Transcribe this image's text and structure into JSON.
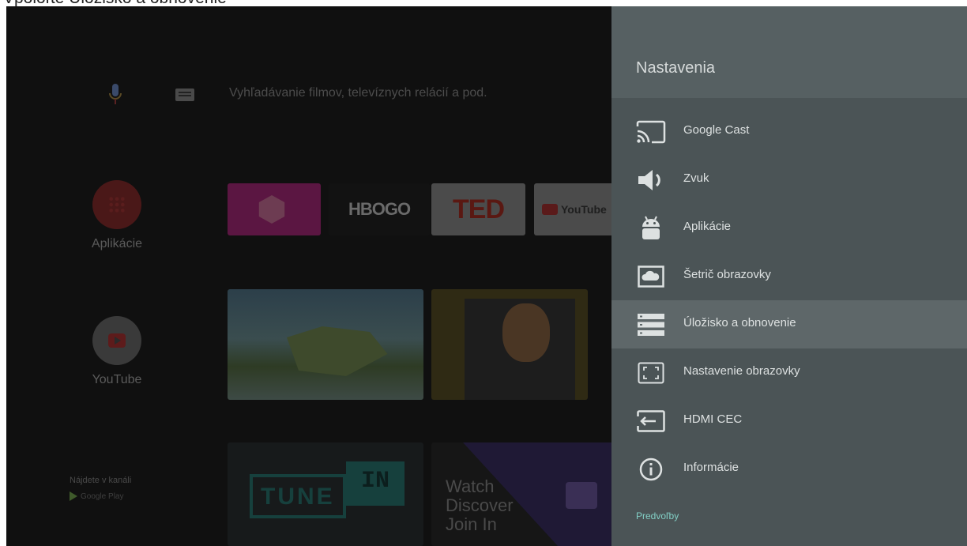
{
  "caption": "Vpoloľte Úložisko a obnovenie",
  "home": {
    "search_placeholder": "Vyhľadávanie filmov, televíznych relácií a pod.",
    "side_apps": [
      {
        "label": "Aplikácie"
      },
      {
        "label": "YouTube"
      }
    ],
    "playstore_line1": "Nájdete v kanáli",
    "playstore_line2": "Google Play",
    "tiles": {
      "hbo": "HBOGO",
      "ted": "TED",
      "youtube": "YouTube",
      "tunein_left": "TUNE",
      "tunein_right": "IN",
      "twitch_lines": [
        "Watch",
        "Discover",
        "Join In"
      ]
    }
  },
  "settings": {
    "title": "Nastavenia",
    "items": [
      {
        "label": "Google Cast",
        "icon": "cast-icon",
        "active": false
      },
      {
        "label": "Zvuk",
        "icon": "speaker-icon",
        "active": false
      },
      {
        "label": "Aplikácie",
        "icon": "android-icon",
        "active": false
      },
      {
        "label": "Šetrič obrazovky",
        "icon": "screensaver-icon",
        "active": false
      },
      {
        "label": "Úložisko a obnovenie",
        "icon": "storage-icon",
        "active": true
      },
      {
        "label": "Nastavenie obrazovky",
        "icon": "display-icon",
        "active": false
      },
      {
        "label": "HDMI CEC",
        "icon": "hdmi-input-icon",
        "active": false
      },
      {
        "label": "Informácie",
        "icon": "info-icon",
        "active": false
      }
    ],
    "section_label": "Predvoľby"
  },
  "colors": {
    "panel_bg": "#4b5456",
    "panel_header": "#566062",
    "active_item": "#5e6769",
    "accent": "#82cfc5"
  }
}
